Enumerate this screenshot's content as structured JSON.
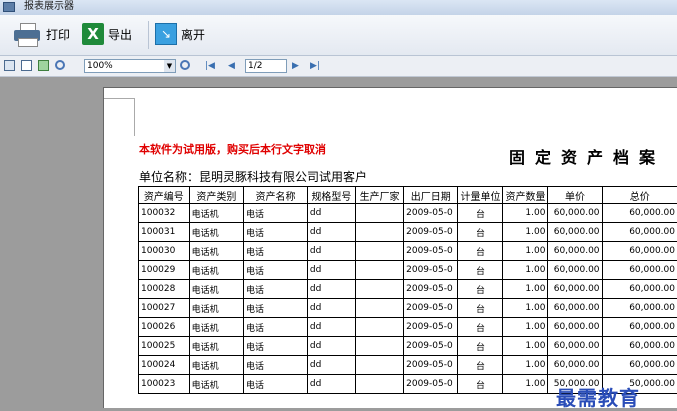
{
  "window": {
    "title": "报表展示器"
  },
  "toolbar": {
    "print_label": "打印",
    "export_label": "导出",
    "exit_label": "离开"
  },
  "navbar": {
    "zoom_value": "100%",
    "page_indicator": "1/2"
  },
  "report": {
    "trial_notice": "本软件为试用版，购买后本行文字取消",
    "title": "固定资产档案",
    "unit_label": "单位名称：昆明灵豚科技有限公司试用客户",
    "columns": [
      "资产编号",
      "资产类别",
      "资产名称",
      "规格型号",
      "生产厂家",
      "出厂日期",
      "计量单位",
      "资产数量",
      "单价",
      "总价"
    ],
    "rows": [
      [
        "100032",
        "电话机",
        "电话",
        "dd",
        "",
        "2009-05-0",
        "台",
        "1.00",
        "60,000.00",
        "60,000.00"
      ],
      [
        "100031",
        "电话机",
        "电话",
        "dd",
        "",
        "2009-05-0",
        "台",
        "1.00",
        "60,000.00",
        "60,000.00"
      ],
      [
        "100030",
        "电话机",
        "电话",
        "dd",
        "",
        "2009-05-0",
        "台",
        "1.00",
        "60,000.00",
        "60,000.00"
      ],
      [
        "100029",
        "电话机",
        "电话",
        "dd",
        "",
        "2009-05-0",
        "台",
        "1.00",
        "60,000.00",
        "60,000.00"
      ],
      [
        "100028",
        "电话机",
        "电话",
        "dd",
        "",
        "2009-05-0",
        "台",
        "1.00",
        "60,000.00",
        "60,000.00"
      ],
      [
        "100027",
        "电话机",
        "电话",
        "dd",
        "",
        "2009-05-0",
        "台",
        "1.00",
        "60,000.00",
        "60,000.00"
      ],
      [
        "100026",
        "电话机",
        "电话",
        "dd",
        "",
        "2009-05-0",
        "台",
        "1.00",
        "60,000.00",
        "60,000.00"
      ],
      [
        "100025",
        "电话机",
        "电话",
        "dd",
        "",
        "2009-05-0",
        "台",
        "1.00",
        "60,000.00",
        "60,000.00"
      ],
      [
        "100024",
        "电话机",
        "电话",
        "dd",
        "",
        "2009-05-0",
        "台",
        "1.00",
        "60,000.00",
        "60,000.00"
      ],
      [
        "100023",
        "电话机",
        "电话",
        "dd",
        "",
        "2009-05-0",
        "台",
        "1.00",
        "50,000.00",
        "50,000.00"
      ]
    ]
  },
  "watermark": "最需教育"
}
